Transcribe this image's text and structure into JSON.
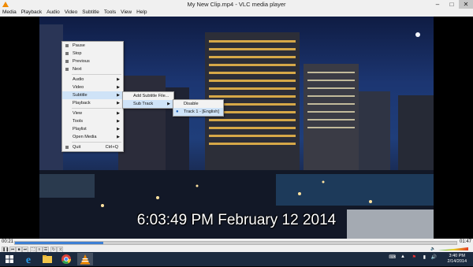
{
  "window": {
    "title": "My New Clip.mp4 - VLC media player",
    "controls": {
      "minimize": "–",
      "maximize": "□",
      "close": "✕"
    }
  },
  "menubar": [
    "Media",
    "Playback",
    "Audio",
    "Video",
    "Subtitle",
    "Tools",
    "View",
    "Help"
  ],
  "video": {
    "subtitle_overlay": "6:03:49 PM February 12 2014"
  },
  "context_menu": {
    "items": [
      {
        "label": "Pause"
      },
      {
        "label": "Stop"
      },
      {
        "label": "Previous"
      },
      {
        "label": "Next"
      },
      {
        "label": "Audio",
        "submenu": true
      },
      {
        "label": "Video",
        "submenu": true
      },
      {
        "label": "Subtitle",
        "submenu": true,
        "highlighted": true
      },
      {
        "label": "Playback",
        "submenu": true
      },
      {
        "label": "View",
        "submenu": true
      },
      {
        "label": "Tools",
        "submenu": true
      },
      {
        "label": "Playlist",
        "submenu": true
      },
      {
        "label": "Open Media",
        "submenu": true
      },
      {
        "label": "Quit",
        "shortcut": "Ctrl+Q"
      }
    ]
  },
  "subtitle_menu": {
    "items": [
      {
        "label": "Add Subtitle File..."
      },
      {
        "label": "Sub Track",
        "submenu": true,
        "highlighted": true
      }
    ]
  },
  "subtrack_menu": {
    "items": [
      {
        "label": "Disable"
      },
      {
        "label": "Track 1 - [English]",
        "checked": true,
        "highlighted": true
      }
    ]
  },
  "player": {
    "elapsed": "00:21",
    "total": "01:47",
    "progress_fraction": 0.2,
    "volume_percent": 100
  },
  "taskbar": {
    "apps": [
      "windows-logo",
      "internet-explorer",
      "file-explorer",
      "chrome",
      "vlc"
    ],
    "clock_time": "3:40 PM",
    "clock_date": "2/14/2014"
  },
  "colors": {
    "accent": "#3d7fd4",
    "highlight": "#cfe3f7",
    "taskbar": "#1b2a3f"
  }
}
